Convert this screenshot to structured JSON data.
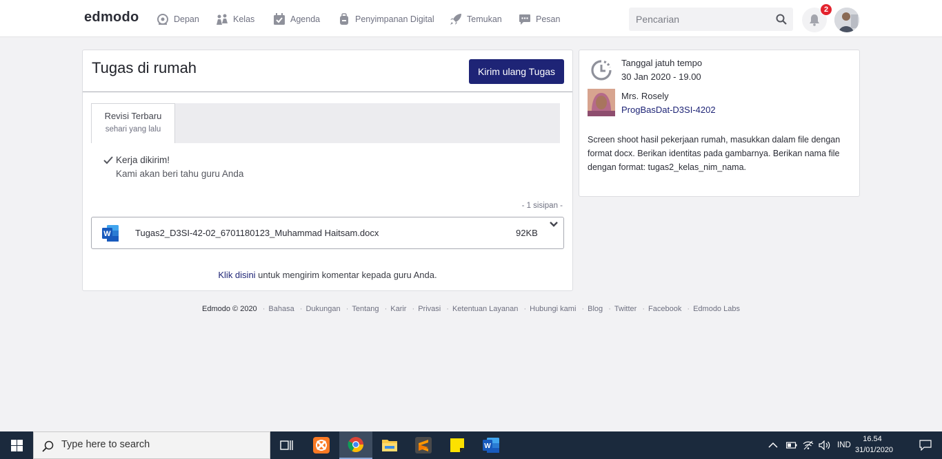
{
  "nav": {
    "logo": "edmodo",
    "items": [
      {
        "label": "Depan",
        "icon": "home-icon"
      },
      {
        "label": "Kelas",
        "icon": "classes-icon"
      },
      {
        "label": "Agenda",
        "icon": "calendar-icon"
      },
      {
        "label": "Penyimpanan Digital",
        "icon": "backpack-icon"
      },
      {
        "label": "Temukan",
        "icon": "rocket-icon"
      },
      {
        "label": "Pesan",
        "icon": "message-icon"
      }
    ],
    "search_placeholder": "Pencarian",
    "notification_count": "2"
  },
  "assignment": {
    "title": "Tugas di rumah",
    "resend_label": "Kirim ulang Tugas",
    "tab_title": "Revisi Terbaru",
    "tab_subtitle": "sehari yang lalu",
    "submitted_title": "Kerja dikirim!",
    "submitted_subtitle": "Kami akan beri tahu guru Anda",
    "attachment_count": "- 1 sisipan  -",
    "file": {
      "name": "Tugas2_D3SI-42-02_6701180123_Muhammad Haitsam.docx",
      "size": "92KB"
    },
    "comment_link": "Klik disini",
    "comment_text": " untuk mengirim komentar kepada guru Anda."
  },
  "details": {
    "due_label": "Tanggal jatuh tempo",
    "due_date": "30 Jan 2020 - 19.00",
    "teacher_name": "Mrs. Rosely",
    "class_name": "ProgBasDat-D3SI-4202",
    "description": "Screen shoot hasil pekerjaan rumah, masukkan dalam file dengan format docx. Berikan identitas pada gambarnya. Berikan nama file dengan format: tugas2_kelas_nim_nama."
  },
  "footer": {
    "copyright": "Edmodo © 2020",
    "links": [
      "Bahasa",
      "Dukungan",
      "Tentang",
      "Karir",
      "Privasi",
      "Ketentuan Layanan",
      "Hubungi kami",
      "Blog",
      "Twitter",
      "Facebook",
      "Edmodo Labs"
    ]
  },
  "taskbar": {
    "search_placeholder": "Type here to search",
    "apps": [
      "task-view-icon",
      "xampp-icon",
      "chrome-icon",
      "file-explorer-icon",
      "sublime-text-icon",
      "sticky-notes-icon",
      "word-icon"
    ],
    "language": "IND",
    "time": "16.54",
    "date": "31/01/2020"
  },
  "colors": {
    "primary_button": "#1e2476",
    "badge": "#e3232e",
    "link": "#1e2476",
    "taskbar": "#1b2a3d"
  }
}
